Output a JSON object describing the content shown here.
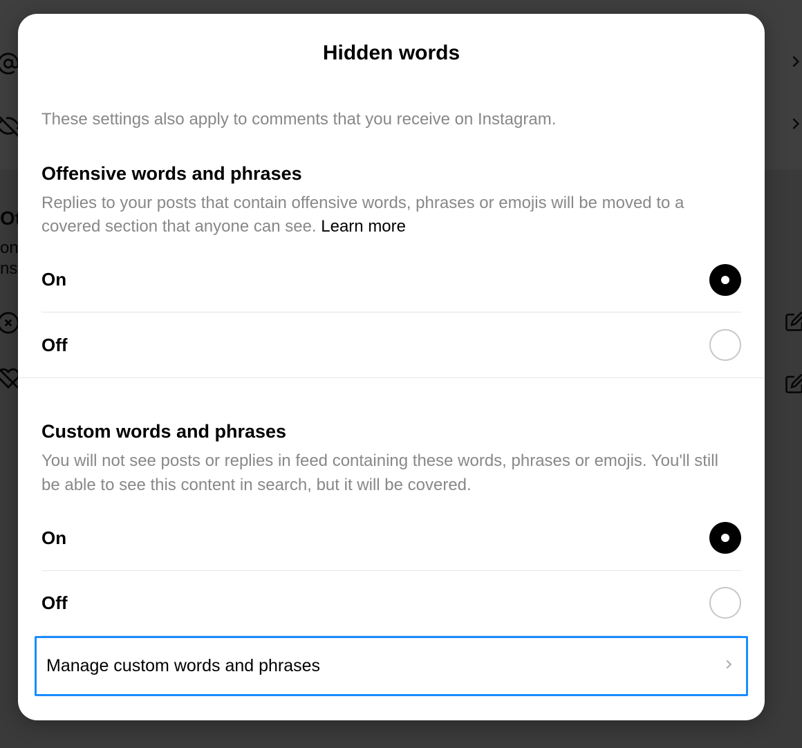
{
  "modal": {
    "title": "Hidden words",
    "subtitle": "These settings also apply to comments that you receive on Instagram.",
    "sections": {
      "offensive": {
        "title": "Offensive words and phrases",
        "description": "Replies to your posts that contain offensive words, phrases or emojis will be moved to a covered section that anyone can see. ",
        "learn_more": "Learn more",
        "options": {
          "on": "On",
          "off": "Off"
        },
        "selected": "on"
      },
      "custom": {
        "title": "Custom words and phrases",
        "description": "You will not see posts or replies in feed containing these words, phrases or emojis. You'll still be able to see this content in search, but it will be covered.",
        "options": {
          "on": "On",
          "off": "Off"
        },
        "selected": "on",
        "manage_label": "Manage custom words and phrases"
      }
    }
  },
  "bg_hints": {
    "other_heading": "Ot",
    "line1": "on",
    "line2": "nst"
  }
}
